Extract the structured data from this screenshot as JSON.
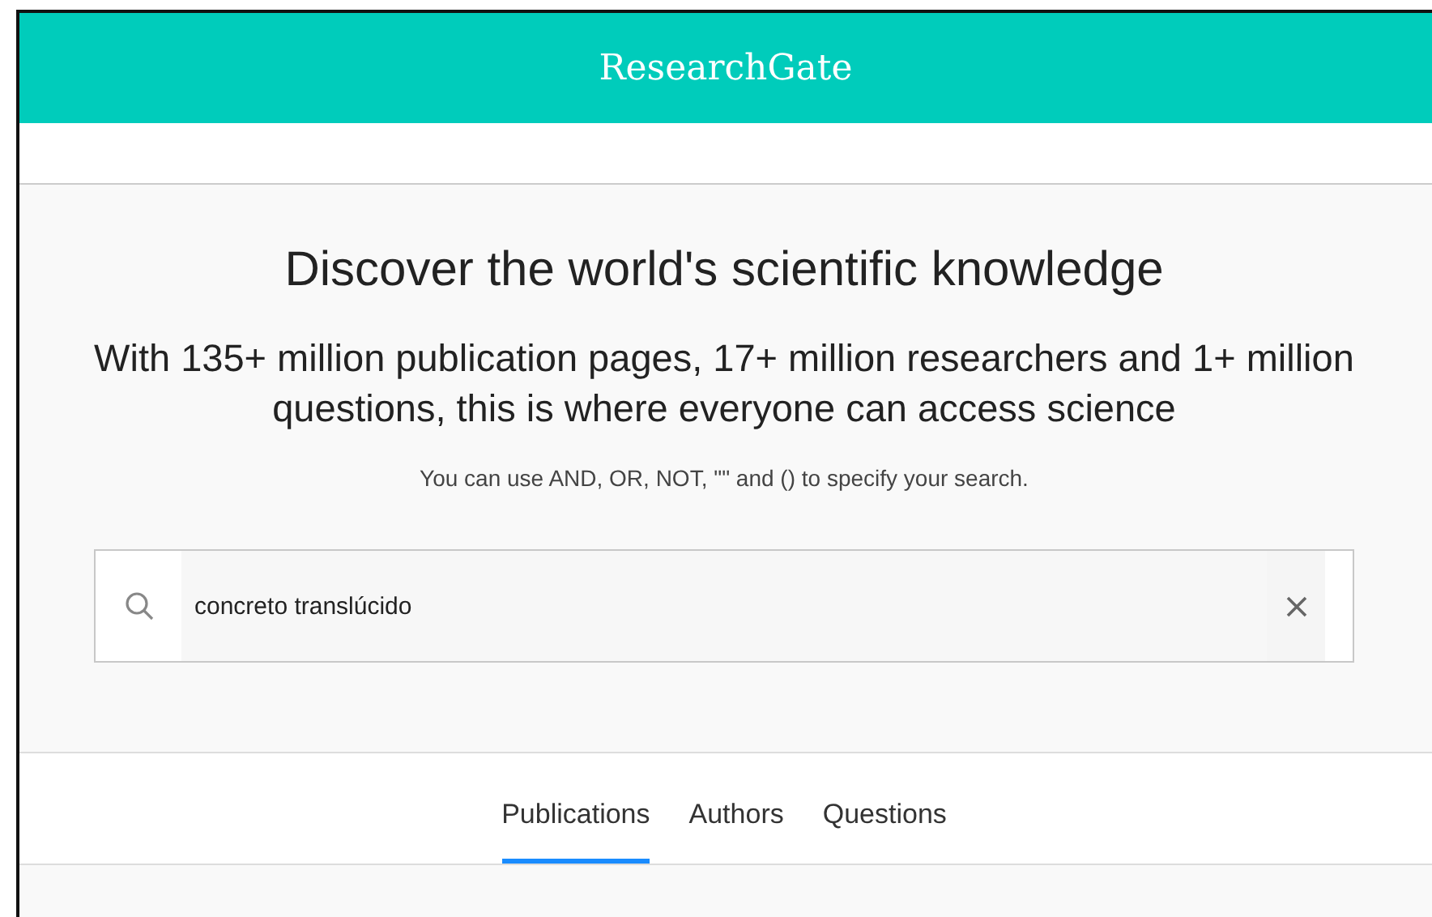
{
  "header": {
    "logo": "ResearchGate"
  },
  "hero": {
    "title": "Discover the world's scientific knowledge",
    "subtitle": "With 135+ million publication pages, 17+ million researchers and 1+ million questions, this is where everyone can access science",
    "hint": "You can use AND, OR, NOT, \"\" and () to specify your search."
  },
  "search": {
    "value": "concreto translúcido"
  },
  "tabs": [
    {
      "label": "Publications",
      "selected": true
    },
    {
      "label": "Authors",
      "selected": false
    },
    {
      "label": "Questions",
      "selected": false
    }
  ]
}
